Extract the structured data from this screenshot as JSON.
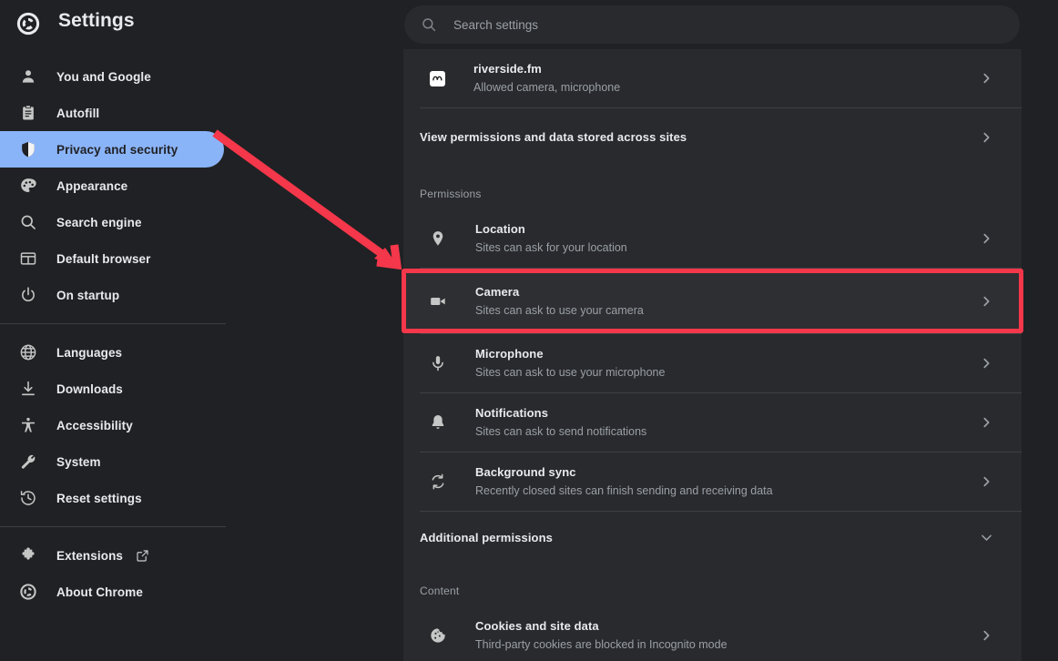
{
  "window": {
    "app_title": "Settings",
    "logo_icon": "chrome-logo-icon"
  },
  "search": {
    "placeholder": "Search settings",
    "value": "",
    "icon": "search-icon"
  },
  "sidebar": {
    "groups": [
      {
        "items": [
          {
            "label": "You and Google",
            "icon": "person-icon",
            "selected": false
          },
          {
            "label": "Autofill",
            "icon": "clipboard-icon",
            "selected": false
          },
          {
            "label": "Privacy and security",
            "icon": "shield-icon",
            "selected": true
          },
          {
            "label": "Appearance",
            "icon": "palette-icon",
            "selected": false
          },
          {
            "label": "Search engine",
            "icon": "search-icon",
            "selected": false
          },
          {
            "label": "Default browser",
            "icon": "browser-window-icon",
            "selected": false
          },
          {
            "label": "On startup",
            "icon": "power-icon",
            "selected": false
          }
        ]
      },
      {
        "items": [
          {
            "label": "Languages",
            "icon": "globe-icon",
            "selected": false
          },
          {
            "label": "Downloads",
            "icon": "download-icon",
            "selected": false
          },
          {
            "label": "Accessibility",
            "icon": "accessibility-icon",
            "selected": false
          },
          {
            "label": "System",
            "icon": "wrench-icon",
            "selected": false
          },
          {
            "label": "Reset settings",
            "icon": "history-restore-icon",
            "selected": false
          }
        ]
      },
      {
        "items": [
          {
            "label": "Extensions",
            "icon": "puzzle-icon",
            "selected": false,
            "external": true
          },
          {
            "label": "About Chrome",
            "icon": "chrome-logo-icon",
            "selected": false
          }
        ]
      }
    ]
  },
  "main": {
    "site_row": {
      "title": "riverside.fm",
      "subtitle": "Allowed camera, microphone",
      "icon": "riverside-favicon",
      "arrow": "chevron-right-icon"
    },
    "view_permissions_row": {
      "label": "View permissions and data stored across sites",
      "arrow": "chevron-right-icon"
    },
    "permissions_section": {
      "heading": "Permissions",
      "rows": [
        {
          "title": "Location",
          "subtitle": "Sites can ask for your location",
          "icon": "location-pin-icon",
          "arrow": "chevron-right-icon",
          "highlighted": false
        },
        {
          "title": "Camera",
          "subtitle": "Sites can ask to use your camera",
          "icon": "video-camera-icon",
          "arrow": "chevron-right-icon",
          "highlighted": true
        },
        {
          "title": "Microphone",
          "subtitle": "Sites can ask to use your microphone",
          "icon": "microphone-icon",
          "arrow": "chevron-right-icon",
          "highlighted": false
        },
        {
          "title": "Notifications",
          "subtitle": "Sites can ask to send notifications",
          "icon": "bell-icon",
          "arrow": "chevron-right-icon",
          "highlighted": false
        },
        {
          "title": "Background sync",
          "subtitle": "Recently closed sites can finish sending and receiving data",
          "icon": "sync-icon",
          "arrow": "chevron-right-icon",
          "highlighted": false
        }
      ],
      "additional": {
        "label": "Additional permissions",
        "arrow": "chevron-down-icon"
      }
    },
    "content_section": {
      "heading": "Content",
      "rows": [
        {
          "title": "Cookies and site data",
          "subtitle": "Third-party cookies are blocked in Incognito mode",
          "icon": "cookie-icon",
          "arrow": "chevron-right-icon"
        }
      ]
    }
  },
  "annotation": {
    "arrow_color": "#f4374a",
    "highlight_color": "#f4374a",
    "arrow_icon": "red-pointer-arrow",
    "highlight_target": "Camera"
  },
  "colors": {
    "page_background": "#202124",
    "card_background": "#292a2d",
    "selected_nav": "#8ab4f8",
    "primary_text": "#e8eaed",
    "secondary_text": "#9aa0a6",
    "divider": "#3c4043"
  }
}
